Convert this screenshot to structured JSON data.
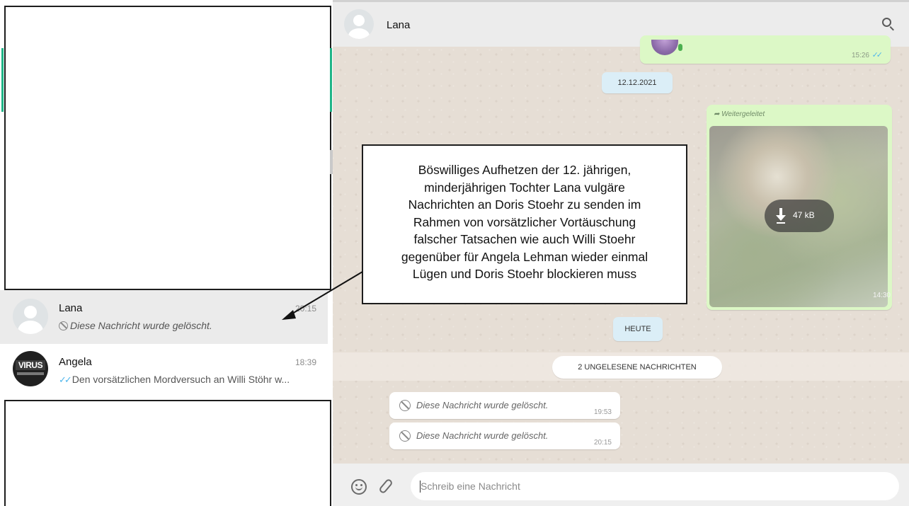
{
  "chats": [
    {
      "name": "Lana",
      "time": "20:15",
      "preview": "Diese Nachricht wurde gelöscht."
    },
    {
      "name": "Angela",
      "time": "18:39",
      "preview": "Den vorsätzlichen Mordversuch an Willi Stöhr w...",
      "avatar_text": "VIRUS"
    }
  ],
  "header": {
    "contact_name": "Lana"
  },
  "messages": {
    "audio_time": "15:26",
    "date_chip": "12.12.2021",
    "forwarded_label": "Weitergeleitet",
    "media_size": "47 kB",
    "media_time": "14:30",
    "today_chip": "HEUTE",
    "unread_chip": "2 UNGELESENE NACHRICHTEN",
    "deleted": [
      {
        "text": "Diese Nachricht wurde gelöscht.",
        "time": "19:53"
      },
      {
        "text": "Diese Nachricht wurde gelöscht.",
        "time": "20:15"
      }
    ]
  },
  "composer": {
    "placeholder": "Schreib eine Nachricht"
  },
  "annotation": {
    "lines": [
      "Böswilliges Aufhetzen der 12. jährigen,",
      "minderjährigen Tochter Lana vulgäre",
      "Nachrichten an Doris Stoehr zu senden im",
      "Rahmen von vorsätzlicher Vortäuschung",
      "falscher Tatsachen wie auch Willi Stoehr",
      "gegenüber für Angela Lehman wieder einmal",
      "Lügen und Doris Stoehr blockieren muss"
    ]
  },
  "colors": {
    "outgoing_bubble": "#dcf8c6",
    "read_ticks": "#4fb6ec",
    "accent_green": "#1fb587",
    "date_chip": "#dbeef7"
  },
  "icons": [
    "search-icon",
    "emoji-icon",
    "attachment-icon",
    "download-icon",
    "deleted-icon",
    "forward-icon",
    "read-ticks-icon"
  ]
}
